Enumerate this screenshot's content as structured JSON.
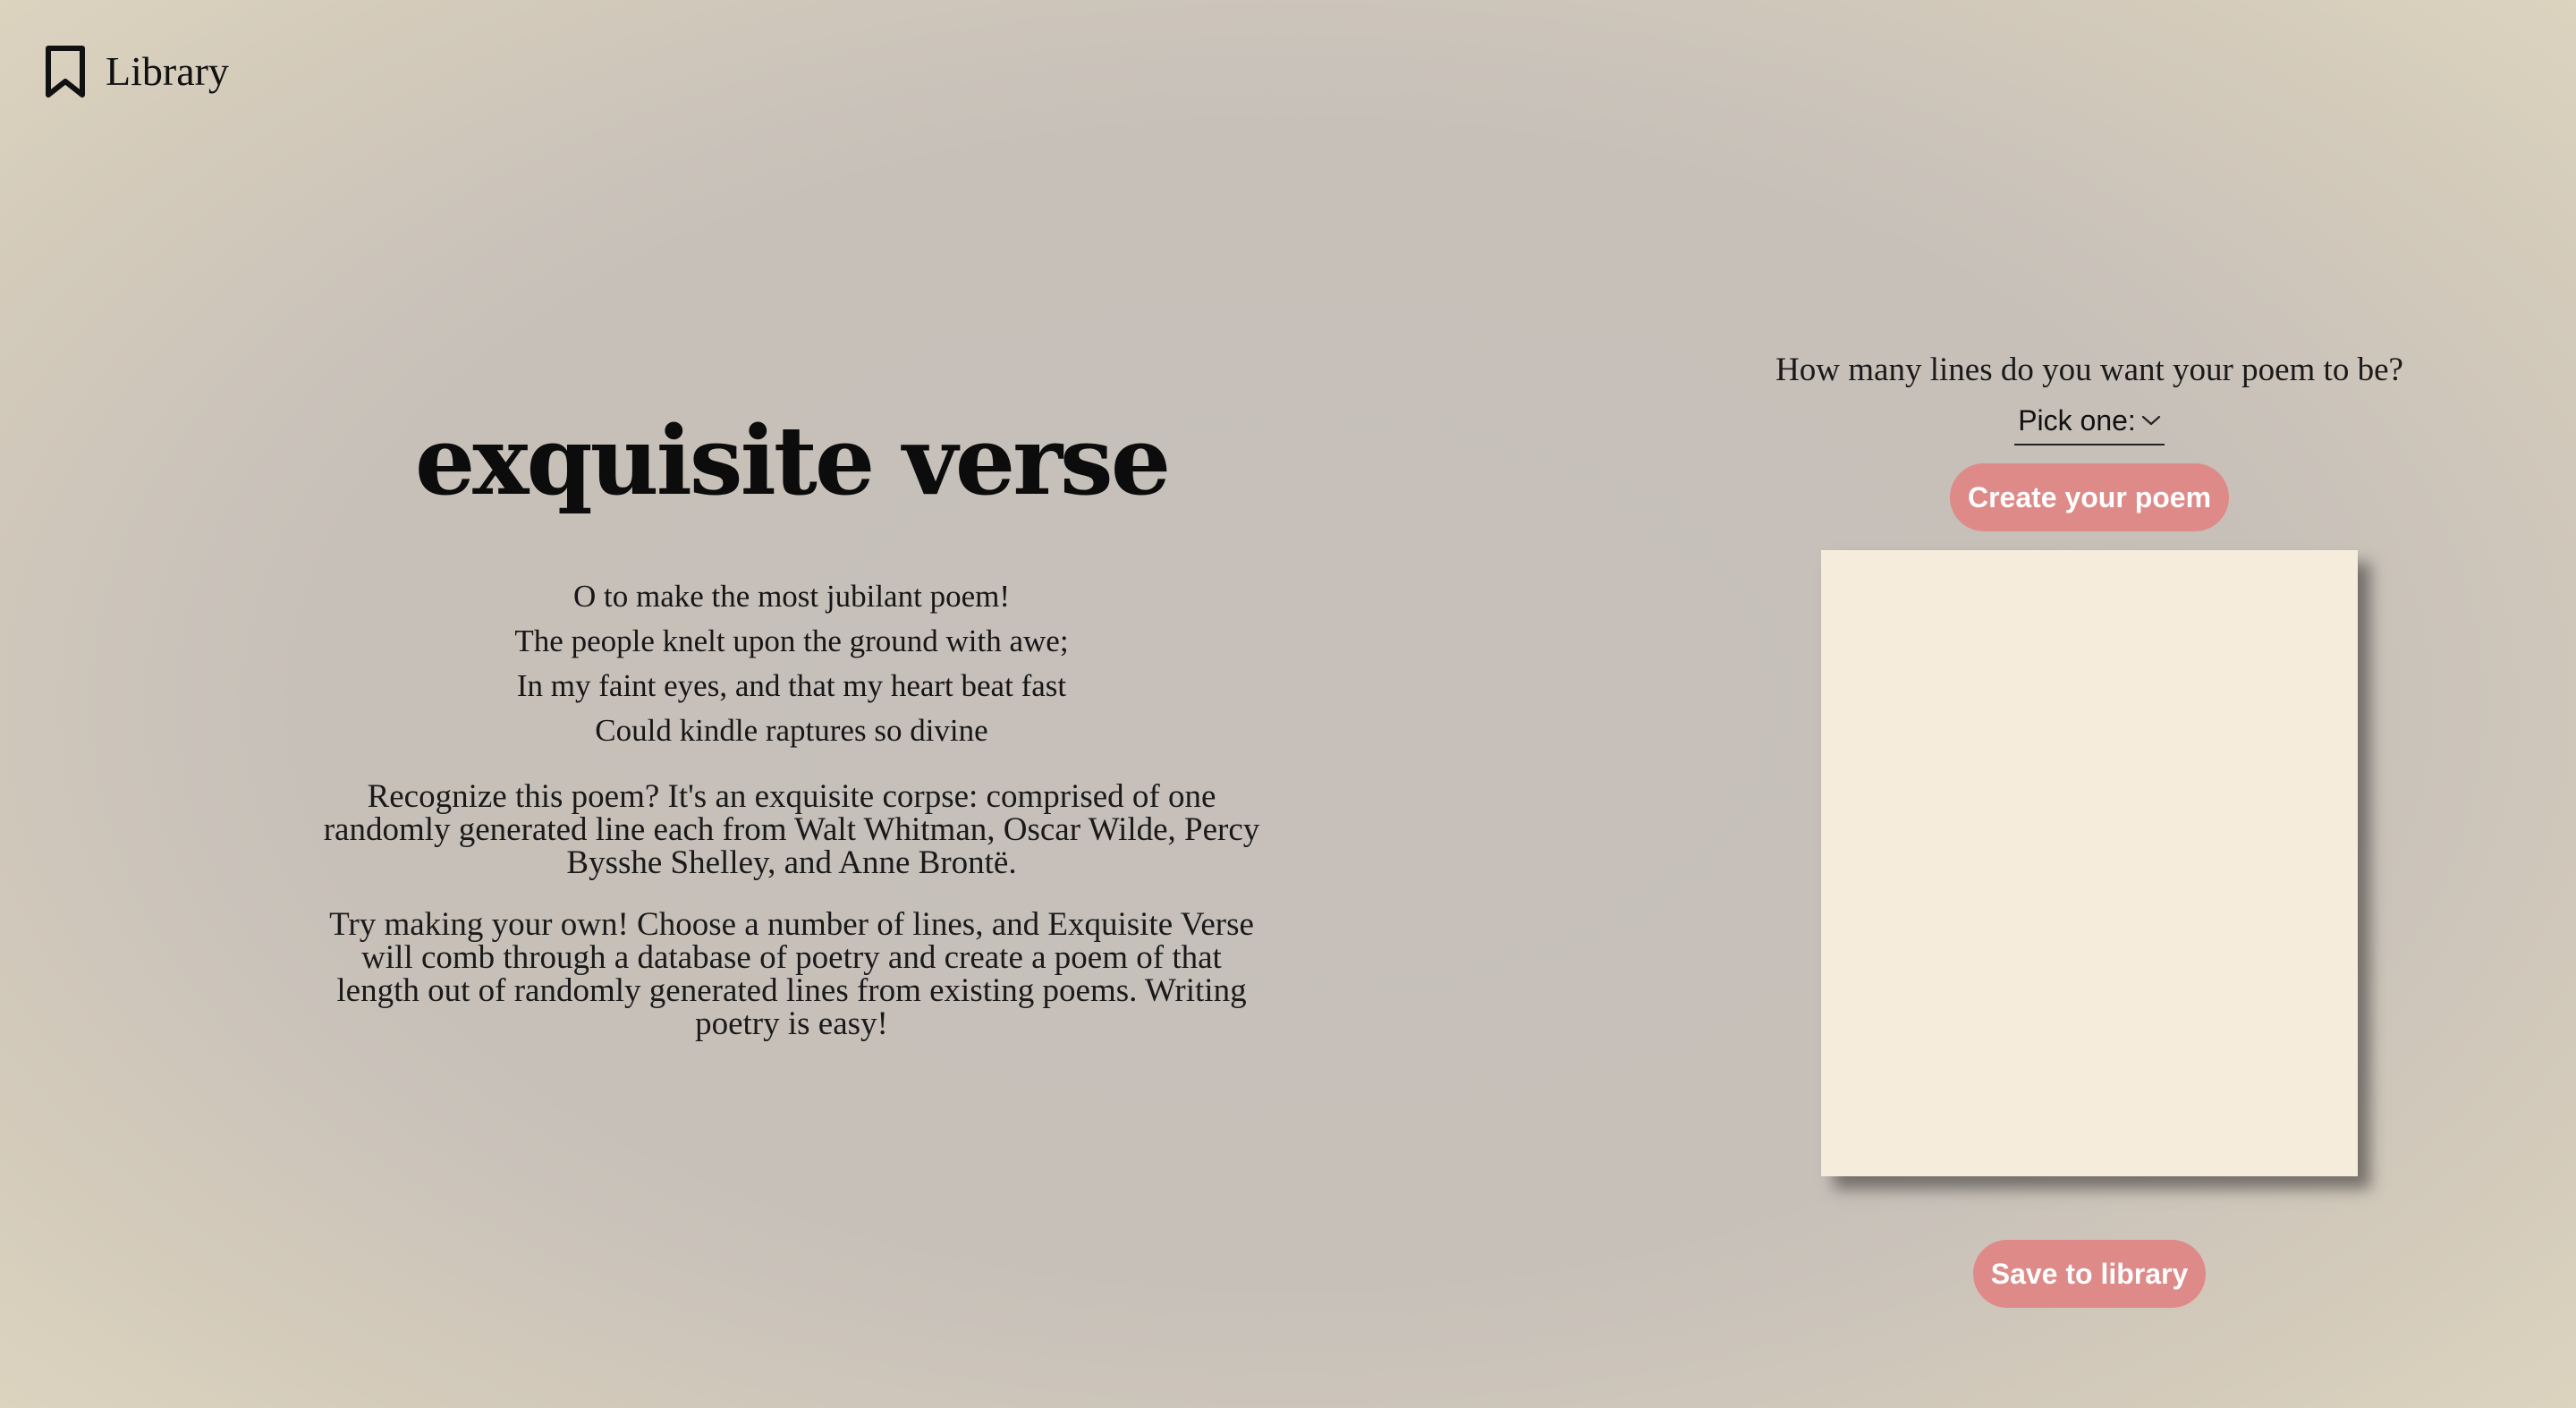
{
  "nav": {
    "library_label": "Library"
  },
  "intro": {
    "title": "exquisite verse",
    "poem_lines": [
      "O to make the most jubilant poem!",
      "The people knelt upon the ground with awe;",
      "In my faint eyes, and that my heart beat fast",
      "Could kindle raptures so divine"
    ],
    "paragraph_1": "Recognize this poem? It's an exquisite corpse: comprised of one randomly generated line each from Walt Whitman, Oscar Wilde, Percy Bysshe Shelley, and Anne Brontë.",
    "paragraph_2": "Try making your own! Choose a number of lines, and Exquisite Verse will comb through a database of poetry and create a poem of that length out of randomly generated lines from existing poems. Writing poetry is easy!"
  },
  "generator": {
    "question": "How many lines do you want your poem to be?",
    "select_value": "Pick one:",
    "create_button": "Create your poem",
    "save_button": "Save to library"
  },
  "colors": {
    "button": "#de8a88",
    "card": "#f6ecdc",
    "background": "#c7c0b9"
  },
  "icons": {
    "library": "bookmark-icon",
    "select": "chevron-down-icon"
  }
}
